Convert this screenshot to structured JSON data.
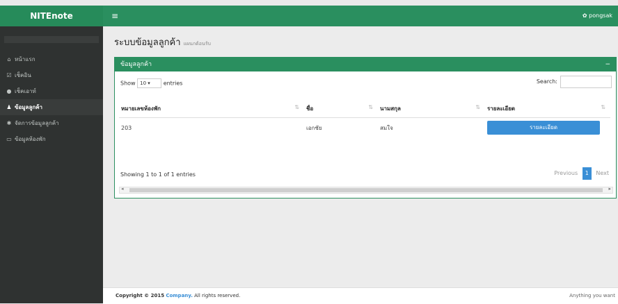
{
  "header": {
    "brand": "NITEnote",
    "menu_icon": "≡",
    "user": "pongsak"
  },
  "sidebar": {
    "items": [
      {
        "icon": "home-icon",
        "glyph": "⌂",
        "label": "หน้าแรก"
      },
      {
        "icon": "checkin-icon",
        "glyph": "☑",
        "label": "เช็คอิน"
      },
      {
        "icon": "checkout-icon",
        "glyph": "●",
        "label": "เช็คเอาท์"
      },
      {
        "icon": "user-icon",
        "glyph": "♟",
        "label": "ข้อมูลลูกค้า"
      },
      {
        "icon": "settings-icon",
        "glyph": "✱",
        "label": "จัดการข้อมูลลูกค้า"
      },
      {
        "icon": "monitor-icon",
        "glyph": "▭",
        "label": "ข้อมูลห้องพัก"
      }
    ]
  },
  "page": {
    "title": "ระบบข้อมูลลูกค้า",
    "subtitle": "แผนกต้อนรับ"
  },
  "box": {
    "title": "ข้อมูลลูกค้า",
    "collapse": "−"
  },
  "table_controls": {
    "show": "Show",
    "entries_value": "10",
    "entries": "entries",
    "search_label": "Search:"
  },
  "table": {
    "headers": [
      "หมายเลขห้องพัก",
      "ชื่อ",
      "นามสกุล",
      "รายละเอียด"
    ],
    "rows": [
      {
        "room": "203",
        "first": "เอกชัย",
        "last": "สมใจ",
        "detail": "รายละเอียด"
      }
    ]
  },
  "info": "Showing 1 to 1 of 1 entries",
  "pagination": {
    "previous": "Previous",
    "current": "1",
    "next": "Next"
  },
  "footer": {
    "copy": "Copyright © 2015",
    "company": "Company.",
    "rights": "All rights reserved.",
    "right": "Anything you want"
  }
}
